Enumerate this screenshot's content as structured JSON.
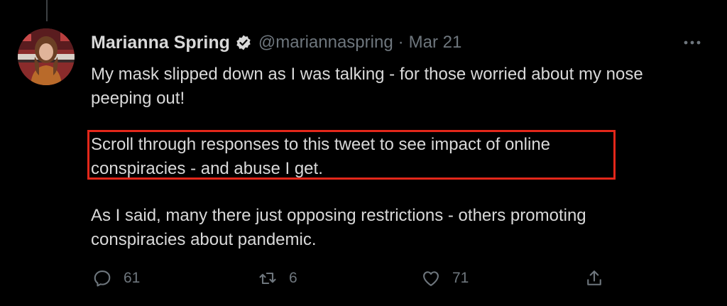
{
  "tweet": {
    "author_name": "Marianna Spring",
    "handle": "@mariannaspring",
    "separator": "·",
    "date": "Mar 21",
    "verified": true,
    "paragraphs": [
      [
        "My mask slipped down as I was talking - for those worried about my nose",
        "peeping out!"
      ],
      [
        "Scroll through responses to this tweet to see impact of online",
        "conspiracies - and abuse I get."
      ],
      [
        "As I said, many there just opposing restrictions - others promoting",
        "conspiracies about pandemic."
      ]
    ],
    "highlighted_paragraph": 1,
    "highlight_color": "#e3271a",
    "text_color": "#d9d9d9",
    "muted_color": "#6e767d",
    "background_color": "#000000"
  },
  "actions": {
    "reply_count": "61",
    "retweet_count": "6",
    "like_count": "71"
  },
  "icons": {
    "more": "more-horizontal-icon",
    "verified": "verified-badge-icon",
    "reply": "reply-icon",
    "retweet": "retweet-icon",
    "like": "heart-icon",
    "share": "share-icon"
  }
}
